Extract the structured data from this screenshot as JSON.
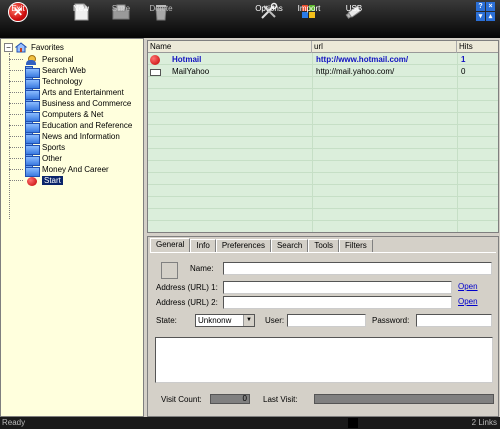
{
  "toolbar": {
    "exit": "Exit",
    "new": "New",
    "save": "Save",
    "delete": "Delete",
    "options": "Options",
    "import": "Import",
    "usb": "USB"
  },
  "window_buttons": {
    "help": "?",
    "close": "×"
  },
  "tree": {
    "root": "Favorites",
    "items": [
      "Personal",
      "Search Web",
      "Technology",
      "Arts and Entertainment",
      "Business and Commerce",
      "Computers & Net",
      "Education and Reference",
      "News and Information",
      "Sports",
      "Other",
      "Money And Career",
      "Start"
    ],
    "selected": "Start"
  },
  "grid": {
    "columns": [
      "Name",
      "url",
      "Hits"
    ],
    "rows": [
      {
        "name": "Hotmail",
        "url": "http://www.hotmail.com/",
        "hits": "1",
        "icon": "apple-icon",
        "bold": true
      },
      {
        "name": "MailYahoo",
        "url": "http://mail.yahoo.com/",
        "hits": "0",
        "icon": "mail-icon",
        "bold": false
      }
    ]
  },
  "detail": {
    "tabs": [
      "General",
      "Info",
      "Preferences",
      "Search",
      "Tools",
      "Filters"
    ],
    "active_tab": "General",
    "name_label": "Name:",
    "url1_label": "Address (URL) 1:",
    "url2_label": "Address (URL) 2:",
    "open1": "Open",
    "open2": "Open",
    "state_label": "State:",
    "state_value": "Unknonw",
    "user_label": "User:",
    "password_label": "Password:",
    "visit_count_label": "Visit Count:",
    "visit_count_value": "0",
    "last_visit_label": "Last Visit:"
  },
  "status": {
    "left": "Ready",
    "right": "2 Links"
  },
  "colors": {
    "tree_bg": "#ffffdd",
    "grid_bg": "#dbeedb",
    "toolbar_bg": "#000000",
    "link": "#0000cc"
  }
}
